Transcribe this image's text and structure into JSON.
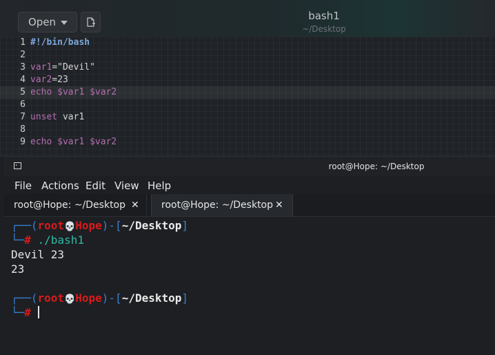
{
  "editor": {
    "open_label": "Open",
    "title": "bash1",
    "subtitle": "~/Desktop",
    "lines": [
      {
        "n": "1",
        "text": "#!/bin/bash"
      },
      {
        "n": "2",
        "text": ""
      },
      {
        "n": "3",
        "text": "var1=\"Devil\""
      },
      {
        "n": "4",
        "text": "var2=23"
      },
      {
        "n": "5",
        "text": "echo $var1 $var2"
      },
      {
        "n": "6",
        "text": ""
      },
      {
        "n": "7",
        "text": "unset var1"
      },
      {
        "n": "8",
        "text": ""
      },
      {
        "n": "9",
        "text": "echo $var1 $var2"
      }
    ],
    "tokens": {
      "l1": "#!/bin/bash",
      "l3_var": "var1",
      "l3_eq": "=",
      "l3_str": "\"Devil\"",
      "l4_var": "var2",
      "l4_eq": "=",
      "l4_val": "23",
      "l5_kw": "echo",
      "l5_args": " $var1 $var2",
      "l7_kw": "unset",
      "l7_arg": " var1",
      "l9_kw": "echo",
      "l9_args": " $var1 $var2"
    }
  },
  "terminal": {
    "title": "root@Hope: ~/Desktop",
    "menu": [
      "File",
      "Actions",
      "Edit",
      "View",
      "Help"
    ],
    "tabs": [
      {
        "label": "root@Hope: ~/Desktop",
        "close": "✕"
      },
      {
        "label": "root@Hope: ~/Desktop",
        "close": "✕"
      }
    ],
    "prompt": {
      "frame_top": "┌──(",
      "user": "root",
      "skull": "💀",
      "host": "Hope",
      "mid": ")-[",
      "path": "~/Desktop",
      "end": "]",
      "frame_bottom": "└─",
      "hash": "#"
    },
    "command": " ./bash1",
    "output": [
      "Devil 23",
      "23"
    ]
  },
  "colors": {
    "prompt_frame": "#3a7fd0",
    "prompt_user": "#d81b1b",
    "command": "#2fb9a5",
    "keyword": "#b36fb0",
    "shebang": "#7aa6da"
  }
}
